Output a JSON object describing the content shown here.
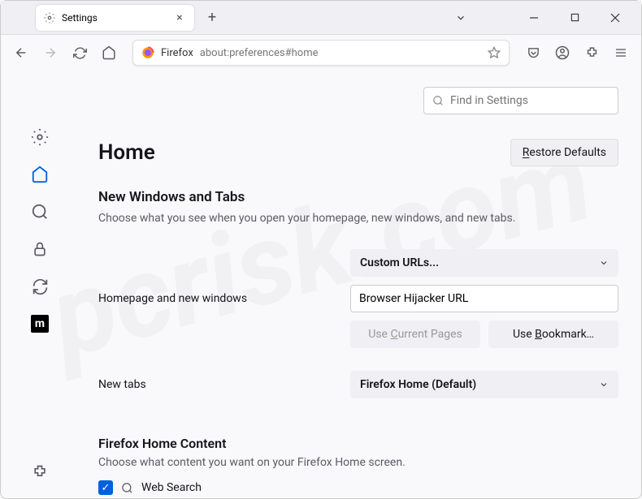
{
  "tab": {
    "title": "Settings"
  },
  "addressbar": {
    "label": "Firefox",
    "url": "about:preferences#home"
  },
  "search": {
    "placeholder": "Find in Settings"
  },
  "page": {
    "title": "Home",
    "restore": "Restore Defaults"
  },
  "section1": {
    "title": "New Windows and Tabs",
    "desc": "Choose what you see when you open your homepage, new windows, and new tabs."
  },
  "homepage": {
    "label": "Homepage and new windows",
    "select": "Custom URLs...",
    "input_value": "Browser Hijacker URL",
    "use_current": "Use Current Pages",
    "use_bookmark": "Use Bookmark…"
  },
  "newtabs": {
    "label": "New tabs",
    "select": "Firefox Home (Default)"
  },
  "section2": {
    "title": "Firefox Home Content",
    "desc": "Choose what content you want on your Firefox Home screen.",
    "checkbox1": "Web Search"
  }
}
